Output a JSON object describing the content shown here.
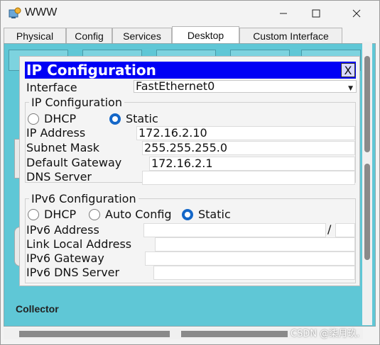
{
  "window": {
    "title": "WWW",
    "icon": "packet-tracer-pc-icon",
    "minimize_icon": "minimize-icon",
    "maximize_icon": "maximize-icon",
    "close_icon": "close-icon"
  },
  "tabs": [
    {
      "label": "Physical",
      "active": false
    },
    {
      "label": "Config",
      "active": false
    },
    {
      "label": "Services",
      "active": false
    },
    {
      "label": "Desktop",
      "active": true
    },
    {
      "label": "Custom Interface",
      "active": false
    }
  ],
  "desktop": {
    "background_color": "#5fc7d6",
    "partial_label": "Collector"
  },
  "dialog": {
    "title": "IP Configuration",
    "close_label": "X",
    "interface_label": "Interface",
    "interface_value": "FastEthernet0",
    "ipv4": {
      "group_title": "IP Configuration",
      "dhcp_label": "DHCP",
      "static_label": "Static",
      "selected_mode": "Static",
      "ip_address_label": "IP Address",
      "ip_address_value": "172.16.2.10",
      "subnet_mask_label": "Subnet Mask",
      "subnet_mask_value": "255.255.255.0",
      "default_gateway_label": "Default Gateway",
      "default_gateway_value": "172.16.2.1",
      "dns_server_label": "DNS Server",
      "dns_server_value": ""
    },
    "ipv6": {
      "group_title": "IPv6 Configuration",
      "dhcp_label": "DHCP",
      "auto_config_label": "Auto Config",
      "static_label": "Static",
      "selected_mode": "Static",
      "ipv6_address_label": "IPv6 Address",
      "ipv6_address_value": "",
      "prefix_separator": "/",
      "prefix_value": "",
      "link_local_label": "Link Local Address",
      "link_local_value": "",
      "ipv6_gateway_label": "IPv6 Gateway",
      "ipv6_gateway_value": "",
      "ipv6_dns_label": "IPv6 DNS Server",
      "ipv6_dns_value": ""
    }
  },
  "watermark": "CSDN @柒月玖.",
  "colors": {
    "header_blue": "#0000f5",
    "radio_selected": "#1467c8",
    "desktop_teal": "#5fc7d6"
  }
}
